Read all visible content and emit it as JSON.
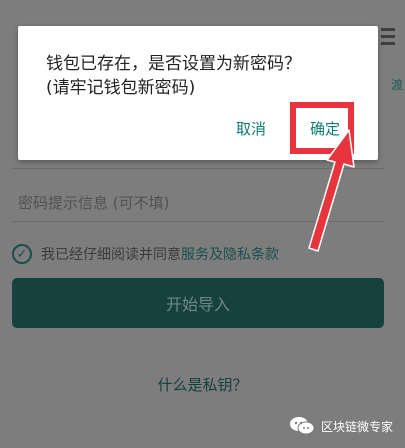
{
  "dialog": {
    "message_line1": "钱包已存在，是否设置为新密码？",
    "message_line2": "(请牢记钱包新密码)",
    "cancel_label": "取消",
    "confirm_label": "确定"
  },
  "background": {
    "edge_text": "渡",
    "hint_placeholder": "密码提示信息 (可不填)",
    "agree_checked": true,
    "agree_text": "我已经仔细阅读并同意",
    "agree_link": "服务及隐私条款",
    "import_button_label": "开始导入",
    "private_key_link": "什么是私钥？"
  },
  "watermark": {
    "text": "区块链微专家",
    "icon": "wechat-icon"
  },
  "colors": {
    "overlay": "#7d7d7d",
    "dialog_button": "#0e7a72",
    "highlight": "#e8343c"
  }
}
